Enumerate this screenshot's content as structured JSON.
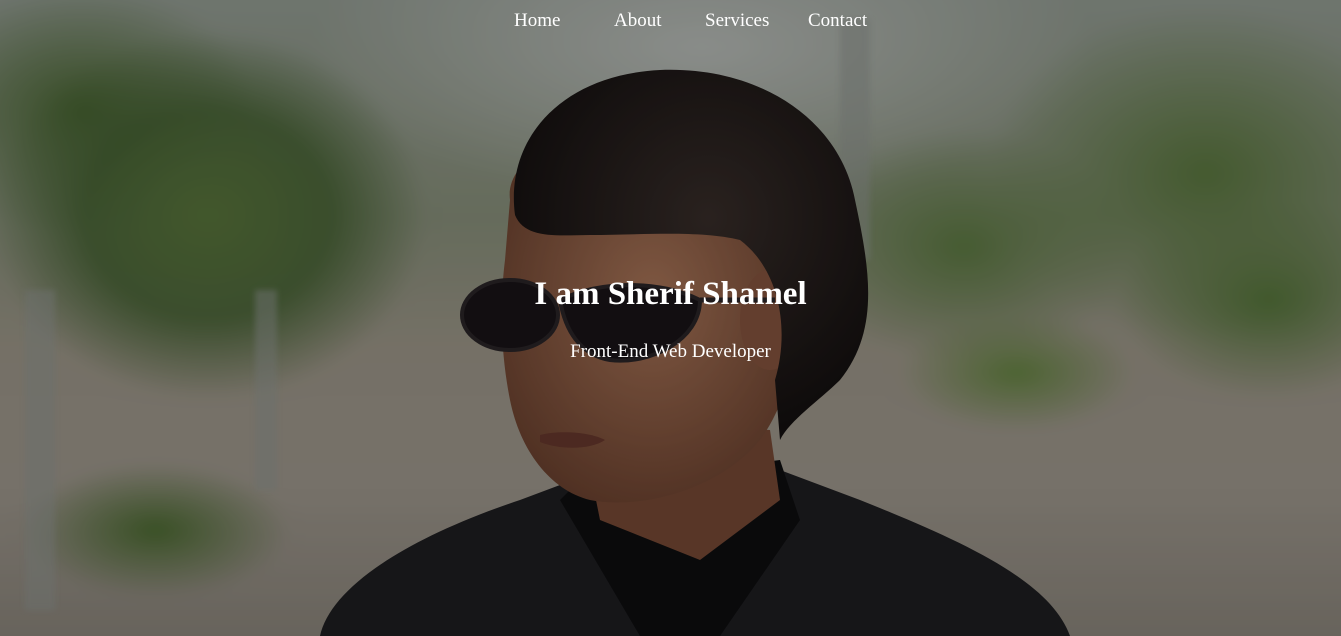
{
  "nav": {
    "items": [
      {
        "label": "Home"
      },
      {
        "label": "About"
      },
      {
        "label": "Services"
      },
      {
        "label": "Contact"
      }
    ]
  },
  "hero": {
    "title": "I am Sherif Shamel",
    "subtitle": "Front-End Web Developer"
  },
  "colors": {
    "text": "#ffffff",
    "overlay": "rgba(0,0,0,0.28)"
  }
}
